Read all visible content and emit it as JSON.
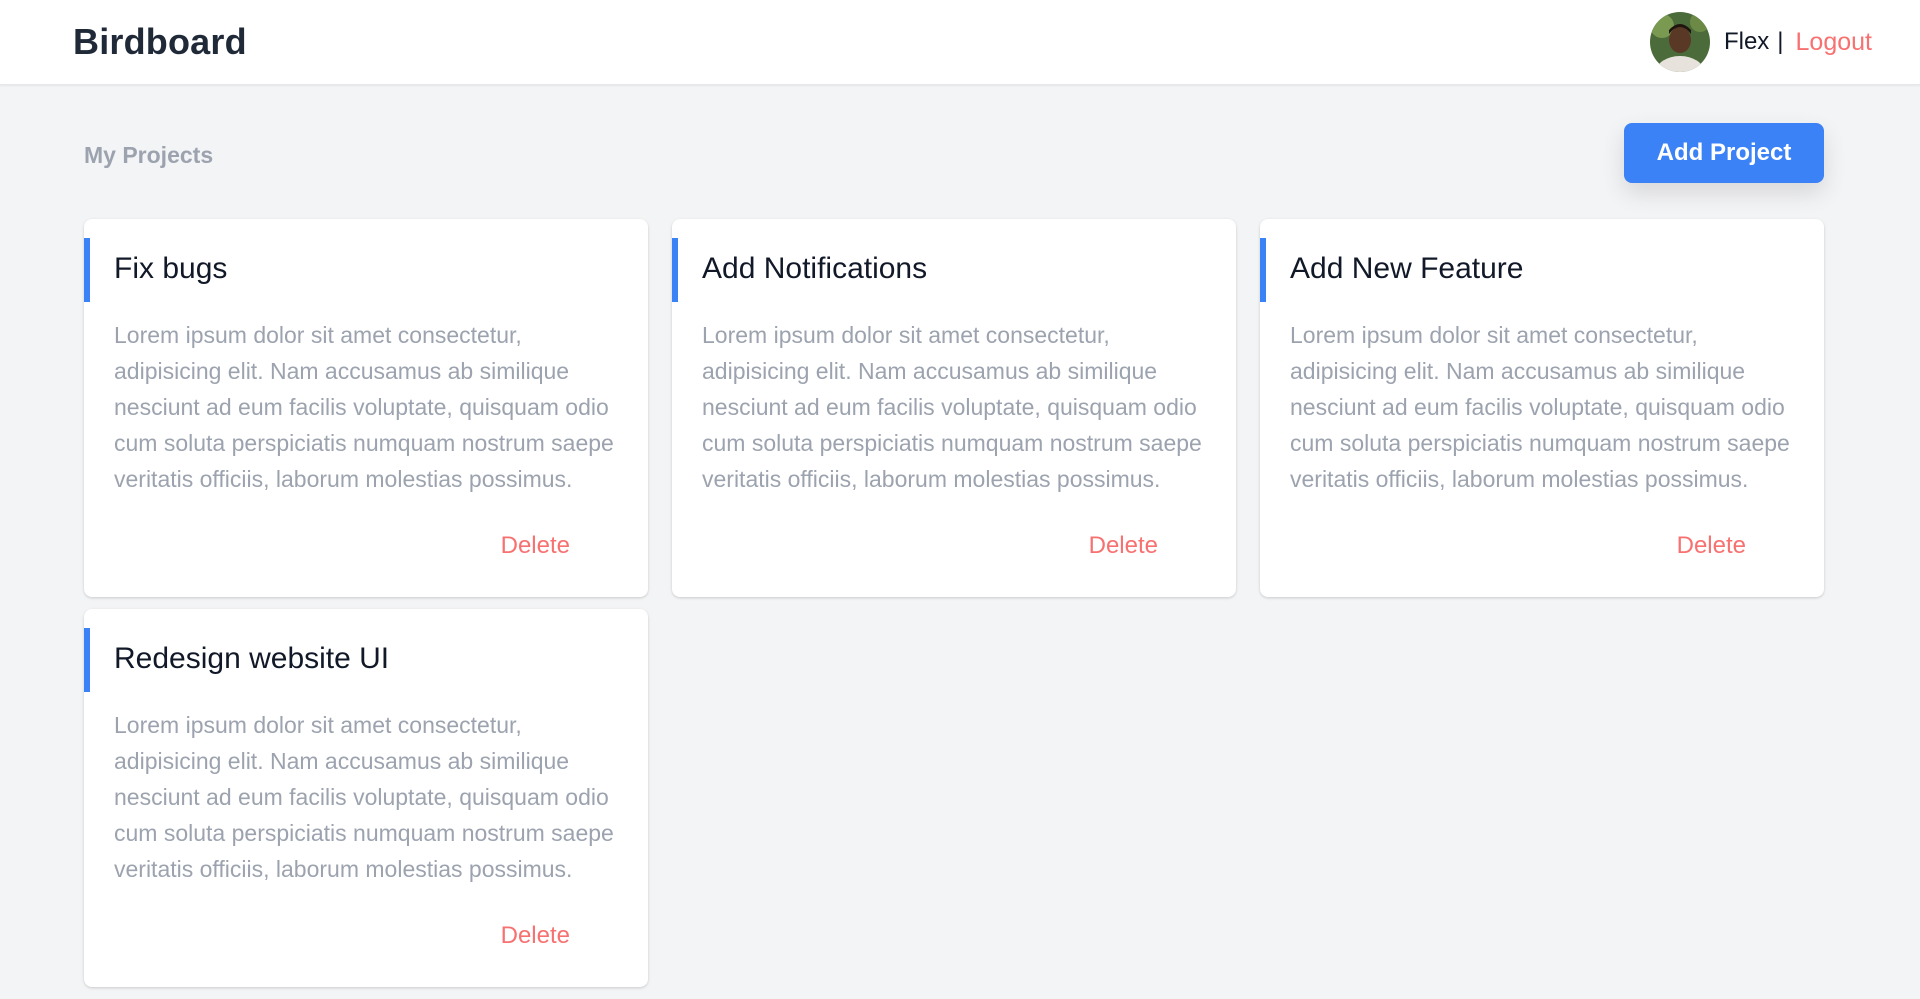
{
  "header": {
    "brand": "Birdboard",
    "user": {
      "name": "Flex",
      "separator": "|",
      "logout_label": "Logout"
    }
  },
  "main": {
    "title": "My Projects",
    "add_button_label": "Add Project",
    "projects": [
      {
        "title": "Fix bugs",
        "description": "Lorem ipsum dolor sit amet consectetur, adipisicing elit. Nam accusamus ab similique nesciunt ad eum facilis voluptate, quisquam odio cum soluta perspiciatis numquam nostrum saepe veritatis officiis, laborum molestias possimus.",
        "delete_label": "Delete"
      },
      {
        "title": "Add Notifications",
        "description": "Lorem ipsum dolor sit amet consectetur, adipisicing elit. Nam accusamus ab similique nesciunt ad eum facilis voluptate, quisquam odio cum soluta perspiciatis numquam nostrum saepe veritatis officiis, laborum molestias possimus.",
        "delete_label": "Delete"
      },
      {
        "title": "Add New Feature",
        "description": "Lorem ipsum dolor sit amet consectetur, adipisicing elit. Nam accusamus ab similique nesciunt ad eum facilis voluptate, quisquam odio cum soluta perspiciatis numquam nostrum saepe veritatis officiis, laborum molestias possimus.",
        "delete_label": "Delete"
      },
      {
        "title": "Redesign website UI",
        "description": "Lorem ipsum dolor sit amet consectetur, adipisicing elit. Nam accusamus ab similique nesciunt ad eum facilis voluptate, quisquam odio cum soluta perspiciatis numquam nostrum saepe veritatis officiis, laborum molestias possimus.",
        "delete_label": "Delete"
      }
    ]
  },
  "colors": {
    "accent": "#3b82f6",
    "danger": "#f87171",
    "muted_text": "#9ca3af",
    "background": "#f3f4f6"
  }
}
